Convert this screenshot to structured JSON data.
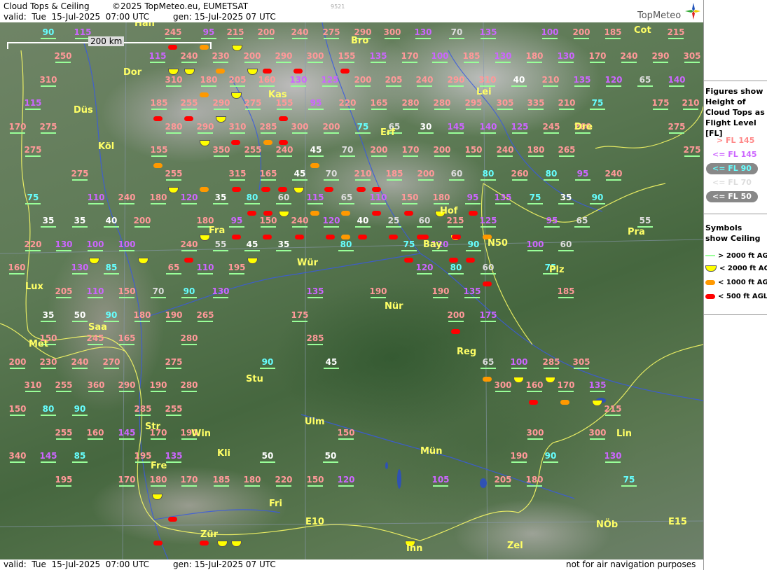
{
  "header": {
    "title": "Cloud Tops & Ceiling",
    "copyright": "©2025 TopMeteo.eu, EUMETSAT",
    "code": "9521",
    "valid": "valid:  Tue  15-Jul-2025  07:00 UTC",
    "gen": "gen: 15-Jul-2025 07 UTC",
    "brand": "TopMeteo"
  },
  "footer": {
    "valid": "valid:  Tue  15-Jul-2025  07:00 UTC",
    "gen": "gen: 15-Jul-2025 07 UTC",
    "note": "not for air navigation purposes"
  },
  "scale": {
    "label": "200 km"
  },
  "legend": {
    "fig_title": "Figures show Height of Cloud Tops as Flight Level  [FL]",
    "levels": [
      {
        "label": "> FL 145",
        "color": "#ff8888"
      },
      {
        "label": "<= FL 145",
        "color": "#cc66ff"
      },
      {
        "label": "<= FL 90",
        "color": "#66ffff"
      },
      {
        "label": "<= FL 70",
        "color": "#dddddd"
      },
      {
        "label": "<= FL 50",
        "color": "#ffffff"
      }
    ],
    "sym_title": "Symbols show Ceiling",
    "symbols": [
      {
        "label": "> 2000 ft AGL",
        "color": "#99ff99"
      },
      {
        "label": "< 2000 ft AGL",
        "color": "#ffff00"
      },
      {
        "label": "< 1000 ft AGL",
        "color": "#ff9900"
      },
      {
        "label": "< 500 ft AGL",
        "color": "#ff0000"
      }
    ]
  },
  "colors": {
    "high": "#ff9999",
    "mid": "#cc66ff",
    "fl90": "#66ffff",
    "fl70": "#dddddd",
    "fl50": "#ffffff",
    "ceil_ok": "#99ff99",
    "ceil_2000": "#ffff00",
    "ceil_1000": "#ff9900",
    "ceil_500": "#ff0000"
  },
  "cities": [
    {
      "name": "Han"
    },
    {
      "name": "Bro"
    },
    {
      "name": "Cot"
    },
    {
      "name": "Dor"
    },
    {
      "name": "Kas"
    },
    {
      "name": "Lei"
    },
    {
      "name": "Düs"
    },
    {
      "name": "Erf"
    },
    {
      "name": "Dre"
    },
    {
      "name": "Köl"
    },
    {
      "name": "Hof"
    },
    {
      "name": "Fra"
    },
    {
      "name": "Pra"
    },
    {
      "name": "Bay"
    },
    {
      "name": "N50"
    },
    {
      "name": "Lux"
    },
    {
      "name": "Wür"
    },
    {
      "name": "Plz"
    },
    {
      "name": "Nür"
    },
    {
      "name": "Saa"
    },
    {
      "name": "Met"
    },
    {
      "name": "Reg"
    },
    {
      "name": "Stu"
    },
    {
      "name": "Str"
    },
    {
      "name": "Ulm"
    },
    {
      "name": "Win"
    },
    {
      "name": "Lin"
    },
    {
      "name": "Kli"
    },
    {
      "name": "Mün"
    },
    {
      "name": "Fre"
    },
    {
      "name": "Fri"
    },
    {
      "name": "E10"
    },
    {
      "name": "NÖb"
    },
    {
      "name": "E15"
    },
    {
      "name": "Zür"
    },
    {
      "name": "Inn"
    },
    {
      "name": "Zel"
    }
  ],
  "labels": [
    {
      "v": "90",
      "c": "fl90"
    },
    {
      "v": "115",
      "c": "mid"
    },
    {
      "v": "245",
      "c": "high"
    },
    {
      "v": "95",
      "c": "mid"
    },
    {
      "v": "215",
      "c": "high"
    },
    {
      "v": "200",
      "c": "high"
    },
    {
      "v": "240",
      "c": "high"
    },
    {
      "v": "275",
      "c": "high"
    },
    {
      "v": "290",
      "c": "high"
    },
    {
      "v": "300",
      "c": "high"
    },
    {
      "v": "130",
      "c": "mid"
    },
    {
      "v": "70",
      "c": "fl70"
    },
    {
      "v": "135",
      "c": "mid"
    },
    {
      "v": "100",
      "c": "mid"
    },
    {
      "v": "200",
      "c": "high"
    },
    {
      "v": "185",
      "c": "high"
    },
    {
      "v": "215",
      "c": "high"
    },
    {
      "v": "250",
      "c": "high"
    },
    {
      "v": "115",
      "c": "mid"
    },
    {
      "v": "240",
      "c": "high"
    },
    {
      "v": "230",
      "c": "high"
    },
    {
      "v": "200",
      "c": "high"
    },
    {
      "v": "290",
      "c": "high"
    },
    {
      "v": "300",
      "c": "high"
    },
    {
      "v": "155",
      "c": "high"
    },
    {
      "v": "135",
      "c": "mid"
    },
    {
      "v": "170",
      "c": "high"
    },
    {
      "v": "100",
      "c": "mid"
    },
    {
      "v": "185",
      "c": "high"
    },
    {
      "v": "130",
      "c": "mid"
    },
    {
      "v": "180",
      "c": "high"
    },
    {
      "v": "130",
      "c": "mid"
    },
    {
      "v": "170",
      "c": "high"
    },
    {
      "v": "240",
      "c": "high"
    },
    {
      "v": "290",
      "c": "high"
    },
    {
      "v": "305",
      "c": "high"
    },
    {
      "v": "310",
      "c": "high"
    },
    {
      "v": "310",
      "c": "high"
    },
    {
      "v": "180",
      "c": "high"
    },
    {
      "v": "205",
      "c": "high"
    },
    {
      "v": "160",
      "c": "high"
    },
    {
      "v": "130",
      "c": "mid"
    },
    {
      "v": "125",
      "c": "mid"
    },
    {
      "v": "200",
      "c": "high"
    },
    {
      "v": "205",
      "c": "high"
    },
    {
      "v": "240",
      "c": "high"
    },
    {
      "v": "290",
      "c": "high"
    },
    {
      "v": "310",
      "c": "high"
    },
    {
      "v": "40",
      "c": "fl50"
    },
    {
      "v": "210",
      "c": "high"
    },
    {
      "v": "135",
      "c": "mid"
    },
    {
      "v": "120",
      "c": "mid"
    },
    {
      "v": "65",
      "c": "fl70"
    },
    {
      "v": "140",
      "c": "mid"
    },
    {
      "v": "115",
      "c": "mid"
    },
    {
      "v": "185",
      "c": "high"
    },
    {
      "v": "255",
      "c": "high"
    },
    {
      "v": "290",
      "c": "high"
    },
    {
      "v": "275",
      "c": "high"
    },
    {
      "v": "155",
      "c": "high"
    },
    {
      "v": "95",
      "c": "mid"
    },
    {
      "v": "220",
      "c": "high"
    },
    {
      "v": "165",
      "c": "high"
    },
    {
      "v": "280",
      "c": "high"
    },
    {
      "v": "280",
      "c": "high"
    },
    {
      "v": "295",
      "c": "high"
    },
    {
      "v": "305",
      "c": "high"
    },
    {
      "v": "335",
      "c": "high"
    },
    {
      "v": "210",
      "c": "high"
    },
    {
      "v": "75",
      "c": "fl90"
    },
    {
      "v": "175",
      "c": "high"
    },
    {
      "v": "210",
      "c": "high"
    },
    {
      "v": "170",
      "c": "high"
    },
    {
      "v": "275",
      "c": "high"
    },
    {
      "v": "280",
      "c": "high"
    },
    {
      "v": "290",
      "c": "high"
    },
    {
      "v": "310",
      "c": "high"
    },
    {
      "v": "285",
      "c": "high"
    },
    {
      "v": "300",
      "c": "high"
    },
    {
      "v": "200",
      "c": "high"
    },
    {
      "v": "75",
      "c": "fl90"
    },
    {
      "v": "65",
      "c": "fl70"
    },
    {
      "v": "30",
      "c": "fl50"
    },
    {
      "v": "145",
      "c": "mid"
    },
    {
      "v": "140",
      "c": "mid"
    },
    {
      "v": "125",
      "c": "mid"
    },
    {
      "v": "245",
      "c": "high"
    },
    {
      "v": "260",
      "c": "high"
    },
    {
      "v": "275",
      "c": "high"
    },
    {
      "v": "275",
      "c": "high"
    },
    {
      "v": "155",
      "c": "high"
    },
    {
      "v": "350",
      "c": "high"
    },
    {
      "v": "255",
      "c": "high"
    },
    {
      "v": "240",
      "c": "high"
    },
    {
      "v": "45",
      "c": "fl50"
    },
    {
      "v": "70",
      "c": "fl70"
    },
    {
      "v": "200",
      "c": "high"
    },
    {
      "v": "170",
      "c": "high"
    },
    {
      "v": "200",
      "c": "high"
    },
    {
      "v": "150",
      "c": "high"
    },
    {
      "v": "240",
      "c": "high"
    },
    {
      "v": "180",
      "c": "high"
    },
    {
      "v": "265",
      "c": "high"
    },
    {
      "v": "275",
      "c": "high"
    },
    {
      "v": "275",
      "c": "high"
    },
    {
      "v": "255",
      "c": "high"
    },
    {
      "v": "315",
      "c": "high"
    },
    {
      "v": "165",
      "c": "high"
    },
    {
      "v": "45",
      "c": "fl50"
    },
    {
      "v": "70",
      "c": "fl70"
    },
    {
      "v": "210",
      "c": "high"
    },
    {
      "v": "185",
      "c": "high"
    },
    {
      "v": "200",
      "c": "high"
    },
    {
      "v": "60",
      "c": "fl70"
    },
    {
      "v": "80",
      "c": "fl90"
    },
    {
      "v": "260",
      "c": "high"
    },
    {
      "v": "80",
      "c": "fl90"
    },
    {
      "v": "95",
      "c": "mid"
    },
    {
      "v": "240",
      "c": "high"
    },
    {
      "v": "75",
      "c": "fl90"
    },
    {
      "v": "110",
      "c": "mid"
    },
    {
      "v": "240",
      "c": "high"
    },
    {
      "v": "180",
      "c": "high"
    },
    {
      "v": "120",
      "c": "mid"
    },
    {
      "v": "35",
      "c": "fl50"
    },
    {
      "v": "80",
      "c": "fl90"
    },
    {
      "v": "60",
      "c": "fl70"
    },
    {
      "v": "115",
      "c": "mid"
    },
    {
      "v": "65",
      "c": "fl70"
    },
    {
      "v": "110",
      "c": "mid"
    },
    {
      "v": "150",
      "c": "high"
    },
    {
      "v": "180",
      "c": "high"
    },
    {
      "v": "95",
      "c": "mid"
    },
    {
      "v": "135",
      "c": "mid"
    },
    {
      "v": "75",
      "c": "fl90"
    },
    {
      "v": "35",
      "c": "fl50"
    },
    {
      "v": "90",
      "c": "fl90"
    },
    {
      "v": "35",
      "c": "fl50"
    },
    {
      "v": "35",
      "c": "fl50"
    },
    {
      "v": "40",
      "c": "fl50"
    },
    {
      "v": "200",
      "c": "high"
    },
    {
      "v": "180",
      "c": "high"
    },
    {
      "v": "95",
      "c": "mid"
    },
    {
      "v": "150",
      "c": "high"
    },
    {
      "v": "240",
      "c": "high"
    },
    {
      "v": "120",
      "c": "mid"
    },
    {
      "v": "40",
      "c": "fl50"
    },
    {
      "v": "25",
      "c": "fl70"
    },
    {
      "v": "60",
      "c": "fl70"
    },
    {
      "v": "215",
      "c": "high"
    },
    {
      "v": "125",
      "c": "mid"
    },
    {
      "v": "95",
      "c": "mid"
    },
    {
      "v": "65",
      "c": "fl70"
    },
    {
      "v": "55",
      "c": "fl70"
    },
    {
      "v": "220",
      "c": "high"
    },
    {
      "v": "130",
      "c": "mid"
    },
    {
      "v": "100",
      "c": "mid"
    },
    {
      "v": "100",
      "c": "mid"
    },
    {
      "v": "240",
      "c": "high"
    },
    {
      "v": "55",
      "c": "fl70"
    },
    {
      "v": "45",
      "c": "fl50"
    },
    {
      "v": "35",
      "c": "fl50"
    },
    {
      "v": "80",
      "c": "fl90"
    },
    {
      "v": "75",
      "c": "fl90"
    },
    {
      "v": "120",
      "c": "mid"
    },
    {
      "v": "90",
      "c": "fl90"
    },
    {
      "v": "100",
      "c": "mid"
    },
    {
      "v": "60",
      "c": "fl70"
    },
    {
      "v": "160",
      "c": "high"
    },
    {
      "v": "130",
      "c": "mid"
    },
    {
      "v": "85",
      "c": "fl90"
    },
    {
      "v": "65",
      "c": "high"
    },
    {
      "v": "110",
      "c": "mid"
    },
    {
      "v": "195",
      "c": "high"
    },
    {
      "v": "120",
      "c": "mid"
    },
    {
      "v": "80",
      "c": "fl90"
    },
    {
      "v": "60",
      "c": "fl70"
    },
    {
      "v": "75",
      "c": "fl90"
    },
    {
      "v": "205",
      "c": "high"
    },
    {
      "v": "110",
      "c": "mid"
    },
    {
      "v": "150",
      "c": "high"
    },
    {
      "v": "70",
      "c": "fl70"
    },
    {
      "v": "90",
      "c": "fl90"
    },
    {
      "v": "130",
      "c": "mid"
    },
    {
      "v": "135",
      "c": "mid"
    },
    {
      "v": "190",
      "c": "high"
    },
    {
      "v": "190",
      "c": "high"
    },
    {
      "v": "135",
      "c": "mid"
    },
    {
      "v": "185",
      "c": "high"
    },
    {
      "v": "35",
      "c": "fl50"
    },
    {
      "v": "50",
      "c": "fl50"
    },
    {
      "v": "90",
      "c": "fl90"
    },
    {
      "v": "180",
      "c": "high"
    },
    {
      "v": "190",
      "c": "high"
    },
    {
      "v": "265",
      "c": "high"
    },
    {
      "v": "175",
      "c": "high"
    },
    {
      "v": "200",
      "c": "high"
    },
    {
      "v": "175",
      "c": "mid"
    },
    {
      "v": "150",
      "c": "high"
    },
    {
      "v": "245",
      "c": "high"
    },
    {
      "v": "165",
      "c": "high"
    },
    {
      "v": "280",
      "c": "high"
    },
    {
      "v": "285",
      "c": "high"
    },
    {
      "v": "200",
      "c": "high"
    },
    {
      "v": "230",
      "c": "high"
    },
    {
      "v": "240",
      "c": "high"
    },
    {
      "v": "270",
      "c": "high"
    },
    {
      "v": "275",
      "c": "high"
    },
    {
      "v": "90",
      "c": "fl90"
    },
    {
      "v": "45",
      "c": "fl50"
    },
    {
      "v": "65",
      "c": "fl70"
    },
    {
      "v": "100",
      "c": "mid"
    },
    {
      "v": "285",
      "c": "high"
    },
    {
      "v": "305",
      "c": "high"
    },
    {
      "v": "310",
      "c": "high"
    },
    {
      "v": "255",
      "c": "high"
    },
    {
      "v": "360",
      "c": "high"
    },
    {
      "v": "290",
      "c": "high"
    },
    {
      "v": "190",
      "c": "high"
    },
    {
      "v": "280",
      "c": "high"
    },
    {
      "v": "300",
      "c": "high"
    },
    {
      "v": "160",
      "c": "high"
    },
    {
      "v": "170",
      "c": "high"
    },
    {
      "v": "135",
      "c": "mid"
    },
    {
      "v": "150",
      "c": "high"
    },
    {
      "v": "80",
      "c": "fl90"
    },
    {
      "v": "90",
      "c": "fl90"
    },
    {
      "v": "285",
      "c": "high"
    },
    {
      "v": "255",
      "c": "high"
    },
    {
      "v": "215",
      "c": "high"
    },
    {
      "v": "255",
      "c": "high"
    },
    {
      "v": "160",
      "c": "high"
    },
    {
      "v": "145",
      "c": "mid"
    },
    {
      "v": "170",
      "c": "high"
    },
    {
      "v": "190",
      "c": "high"
    },
    {
      "v": "150",
      "c": "high"
    },
    {
      "v": "300",
      "c": "high"
    },
    {
      "v": "300",
      "c": "high"
    },
    {
      "v": "340",
      "c": "high"
    },
    {
      "v": "145",
      "c": "mid"
    },
    {
      "v": "85",
      "c": "fl90"
    },
    {
      "v": "195",
      "c": "high"
    },
    {
      "v": "135",
      "c": "mid"
    },
    {
      "v": "50",
      "c": "fl50"
    },
    {
      "v": "50",
      "c": "fl50"
    },
    {
      "v": "190",
      "c": "high"
    },
    {
      "v": "90",
      "c": "fl90"
    },
    {
      "v": "130",
      "c": "mid"
    },
    {
      "v": "195",
      "c": "high"
    },
    {
      "v": "170",
      "c": "high"
    },
    {
      "v": "180",
      "c": "high"
    },
    {
      "v": "170",
      "c": "high"
    },
    {
      "v": "185",
      "c": "high"
    },
    {
      "v": "180",
      "c": "high"
    },
    {
      "v": "220",
      "c": "high"
    },
    {
      "v": "150",
      "c": "high"
    },
    {
      "v": "120",
      "c": "mid"
    },
    {
      "v": "105",
      "c": "mid"
    },
    {
      "v": "205",
      "c": "high"
    },
    {
      "v": "180",
      "c": "high"
    },
    {
      "v": "75",
      "c": "fl90"
    }
  ],
  "symbols_on_map": [
    {
      "t": "s2000"
    },
    {
      "t": "s500"
    },
    {
      "t": "s1000"
    },
    {
      "t": "s2000"
    },
    {
      "t": "s2000"
    },
    {
      "t": "s500"
    },
    {
      "t": "s500"
    },
    {
      "t": "s500"
    },
    {
      "t": "s2000"
    },
    {
      "t": "s1000"
    },
    {
      "t": "s2000"
    },
    {
      "t": "s1000"
    },
    {
      "t": "s500"
    },
    {
      "t": "s500"
    },
    {
      "t": "s500"
    },
    {
      "t": "s2000"
    },
    {
      "t": "s2000"
    },
    {
      "t": "s1000"
    },
    {
      "t": "s500"
    },
    {
      "t": "s500"
    },
    {
      "t": "s1000"
    },
    {
      "t": "s1000"
    },
    {
      "t": "s500"
    },
    {
      "t": "s1000"
    },
    {
      "t": "s1000"
    },
    {
      "t": "s2000"
    },
    {
      "t": "s1000"
    },
    {
      "t": "s500"
    },
    {
      "t": "s500"
    },
    {
      "t": "s2000"
    },
    {
      "t": "s500"
    },
    {
      "t": "s500"
    },
    {
      "t": "s500"
    },
    {
      "t": "s500"
    },
    {
      "t": "s500"
    },
    {
      "t": "s2000"
    },
    {
      "t": "s1000"
    },
    {
      "t": "s500"
    },
    {
      "t": "s500"
    },
    {
      "t": "s500"
    },
    {
      "t": "s500"
    },
    {
      "t": "s2000"
    },
    {
      "t": "s500"
    },
    {
      "t": "s1000"
    },
    {
      "t": "s2000"
    },
    {
      "t": "s500"
    },
    {
      "t": "s500"
    },
    {
      "t": "s2000"
    },
    {
      "t": "s500"
    },
    {
      "t": "s500"
    },
    {
      "t": "s500"
    },
    {
      "t": "s500"
    },
    {
      "t": "s500"
    },
    {
      "t": "s500"
    },
    {
      "t": "s1000"
    },
    {
      "t": "s2000"
    },
    {
      "t": "s2000"
    },
    {
      "t": "s500"
    },
    {
      "t": "s2000"
    },
    {
      "t": "s500"
    },
    {
      "t": "s500"
    },
    {
      "t": "s500"
    },
    {
      "t": "s500"
    },
    {
      "t": "s500"
    },
    {
      "t": "s1000"
    },
    {
      "t": "s2000"
    },
    {
      "t": "s2000"
    },
    {
      "t": "s500"
    },
    {
      "t": "s1000"
    },
    {
      "t": "s2000"
    },
    {
      "t": "s2000"
    },
    {
      "t": "s500"
    },
    {
      "t": "s500"
    },
    {
      "t": "s500"
    },
    {
      "t": "s2000"
    },
    {
      "t": "s500"
    },
    {
      "t": "s500"
    },
    {
      "t": "s2000"
    },
    {
      "t": "s500"
    },
    {
      "t": "s500"
    },
    {
      "t": "s2000"
    },
    {
      "t": "s500"
    }
  ]
}
